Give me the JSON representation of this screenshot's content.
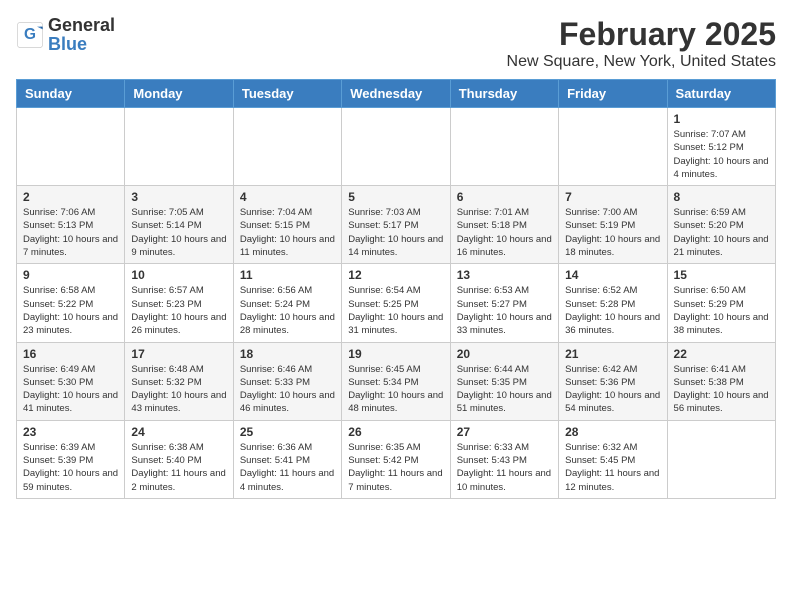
{
  "logo": {
    "general": "General",
    "blue": "Blue"
  },
  "title": "February 2025",
  "subtitle": "New Square, New York, United States",
  "days_of_week": [
    "Sunday",
    "Monday",
    "Tuesday",
    "Wednesday",
    "Thursday",
    "Friday",
    "Saturday"
  ],
  "weeks": [
    [
      {
        "day": "",
        "info": ""
      },
      {
        "day": "",
        "info": ""
      },
      {
        "day": "",
        "info": ""
      },
      {
        "day": "",
        "info": ""
      },
      {
        "day": "",
        "info": ""
      },
      {
        "day": "",
        "info": ""
      },
      {
        "day": "1",
        "info": "Sunrise: 7:07 AM\nSunset: 5:12 PM\nDaylight: 10 hours and 4 minutes."
      }
    ],
    [
      {
        "day": "2",
        "info": "Sunrise: 7:06 AM\nSunset: 5:13 PM\nDaylight: 10 hours and 7 minutes."
      },
      {
        "day": "3",
        "info": "Sunrise: 7:05 AM\nSunset: 5:14 PM\nDaylight: 10 hours and 9 minutes."
      },
      {
        "day": "4",
        "info": "Sunrise: 7:04 AM\nSunset: 5:15 PM\nDaylight: 10 hours and 11 minutes."
      },
      {
        "day": "5",
        "info": "Sunrise: 7:03 AM\nSunset: 5:17 PM\nDaylight: 10 hours and 14 minutes."
      },
      {
        "day": "6",
        "info": "Sunrise: 7:01 AM\nSunset: 5:18 PM\nDaylight: 10 hours and 16 minutes."
      },
      {
        "day": "7",
        "info": "Sunrise: 7:00 AM\nSunset: 5:19 PM\nDaylight: 10 hours and 18 minutes."
      },
      {
        "day": "8",
        "info": "Sunrise: 6:59 AM\nSunset: 5:20 PM\nDaylight: 10 hours and 21 minutes."
      }
    ],
    [
      {
        "day": "9",
        "info": "Sunrise: 6:58 AM\nSunset: 5:22 PM\nDaylight: 10 hours and 23 minutes."
      },
      {
        "day": "10",
        "info": "Sunrise: 6:57 AM\nSunset: 5:23 PM\nDaylight: 10 hours and 26 minutes."
      },
      {
        "day": "11",
        "info": "Sunrise: 6:56 AM\nSunset: 5:24 PM\nDaylight: 10 hours and 28 minutes."
      },
      {
        "day": "12",
        "info": "Sunrise: 6:54 AM\nSunset: 5:25 PM\nDaylight: 10 hours and 31 minutes."
      },
      {
        "day": "13",
        "info": "Sunrise: 6:53 AM\nSunset: 5:27 PM\nDaylight: 10 hours and 33 minutes."
      },
      {
        "day": "14",
        "info": "Sunrise: 6:52 AM\nSunset: 5:28 PM\nDaylight: 10 hours and 36 minutes."
      },
      {
        "day": "15",
        "info": "Sunrise: 6:50 AM\nSunset: 5:29 PM\nDaylight: 10 hours and 38 minutes."
      }
    ],
    [
      {
        "day": "16",
        "info": "Sunrise: 6:49 AM\nSunset: 5:30 PM\nDaylight: 10 hours and 41 minutes."
      },
      {
        "day": "17",
        "info": "Sunrise: 6:48 AM\nSunset: 5:32 PM\nDaylight: 10 hours and 43 minutes."
      },
      {
        "day": "18",
        "info": "Sunrise: 6:46 AM\nSunset: 5:33 PM\nDaylight: 10 hours and 46 minutes."
      },
      {
        "day": "19",
        "info": "Sunrise: 6:45 AM\nSunset: 5:34 PM\nDaylight: 10 hours and 48 minutes."
      },
      {
        "day": "20",
        "info": "Sunrise: 6:44 AM\nSunset: 5:35 PM\nDaylight: 10 hours and 51 minutes."
      },
      {
        "day": "21",
        "info": "Sunrise: 6:42 AM\nSunset: 5:36 PM\nDaylight: 10 hours and 54 minutes."
      },
      {
        "day": "22",
        "info": "Sunrise: 6:41 AM\nSunset: 5:38 PM\nDaylight: 10 hours and 56 minutes."
      }
    ],
    [
      {
        "day": "23",
        "info": "Sunrise: 6:39 AM\nSunset: 5:39 PM\nDaylight: 10 hours and 59 minutes."
      },
      {
        "day": "24",
        "info": "Sunrise: 6:38 AM\nSunset: 5:40 PM\nDaylight: 11 hours and 2 minutes."
      },
      {
        "day": "25",
        "info": "Sunrise: 6:36 AM\nSunset: 5:41 PM\nDaylight: 11 hours and 4 minutes."
      },
      {
        "day": "26",
        "info": "Sunrise: 6:35 AM\nSunset: 5:42 PM\nDaylight: 11 hours and 7 minutes."
      },
      {
        "day": "27",
        "info": "Sunrise: 6:33 AM\nSunset: 5:43 PM\nDaylight: 11 hours and 10 minutes."
      },
      {
        "day": "28",
        "info": "Sunrise: 6:32 AM\nSunset: 5:45 PM\nDaylight: 11 hours and 12 minutes."
      },
      {
        "day": "",
        "info": ""
      }
    ]
  ]
}
